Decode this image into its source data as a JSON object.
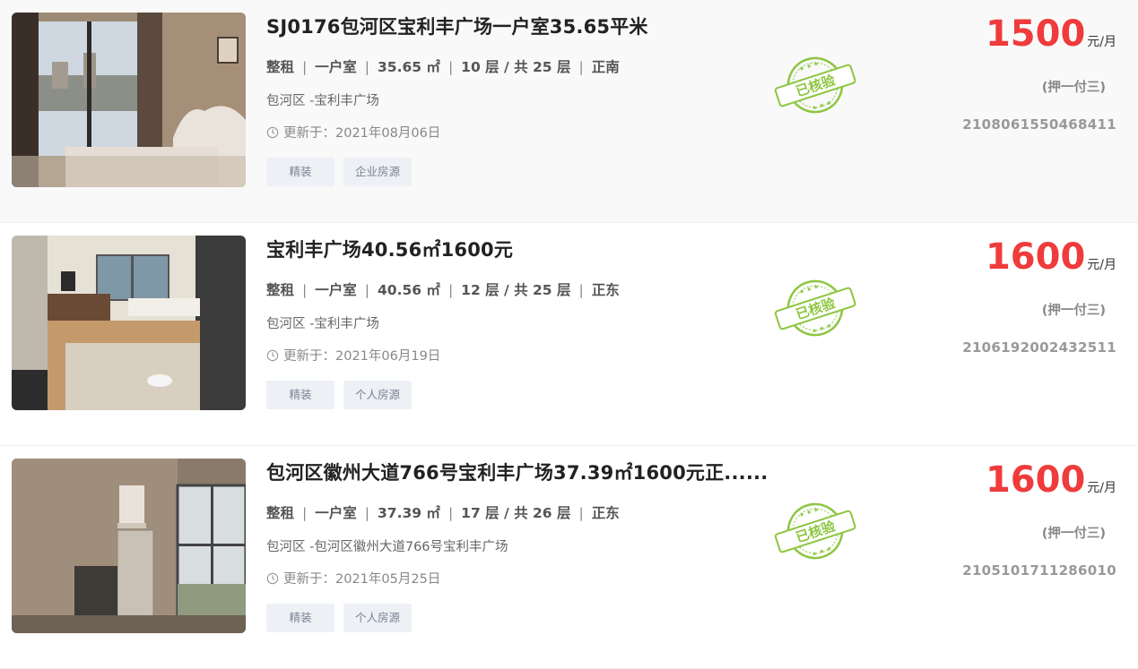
{
  "listings": [
    {
      "title": "SJ0176包河区宝利丰广场一户室35.65平米",
      "rent_type": "整租",
      "layout": "一户室",
      "area": "35.65 ㎡",
      "floor": "10 层 / 共 25 层",
      "orientation": "正南",
      "address": "包河区 -宝利丰广场",
      "updated": "更新于：2021年08月06日",
      "tags": [
        "精装",
        "企业房源"
      ],
      "stamp": "已核验",
      "price": "1500",
      "unit": "元/月",
      "deposit": "(押一付三)",
      "code": "2108061550468411"
    },
    {
      "title": "宝利丰广场40.56㎡1600元",
      "rent_type": "整租",
      "layout": "一户室",
      "area": "40.56 ㎡",
      "floor": "12 层 / 共 25 层",
      "orientation": "正东",
      "address": "包河区 -宝利丰广场",
      "updated": "更新于：2021年06月19日",
      "tags": [
        "精装",
        "个人房源"
      ],
      "stamp": "已核验",
      "price": "1600",
      "unit": "元/月",
      "deposit": "(押一付三)",
      "code": "2106192002432511"
    },
    {
      "title": "包河区徽州大道766号宝利丰广场37.39㎡1600元正......",
      "rent_type": "整租",
      "layout": "一户室",
      "area": "37.39 ㎡",
      "floor": "17 层 / 共 26 层",
      "orientation": "正东",
      "address": "包河区 -包河区徽州大道766号宝利丰广场",
      "updated": "更新于：2021年05月25日",
      "tags": [
        "精装",
        "个人房源"
      ],
      "stamp": "已核验",
      "price": "1600",
      "unit": "元/月",
      "deposit": "(押一付三)",
      "code": "2105101711286010"
    }
  ],
  "colors": {
    "price": "#ef3b3b",
    "stamp": "#8cc63f",
    "tag_bg": "#edf1f5",
    "tag_text": "#7a8494"
  },
  "icons": {
    "clock": "clock-icon",
    "stamp": "verified-stamp-icon"
  }
}
